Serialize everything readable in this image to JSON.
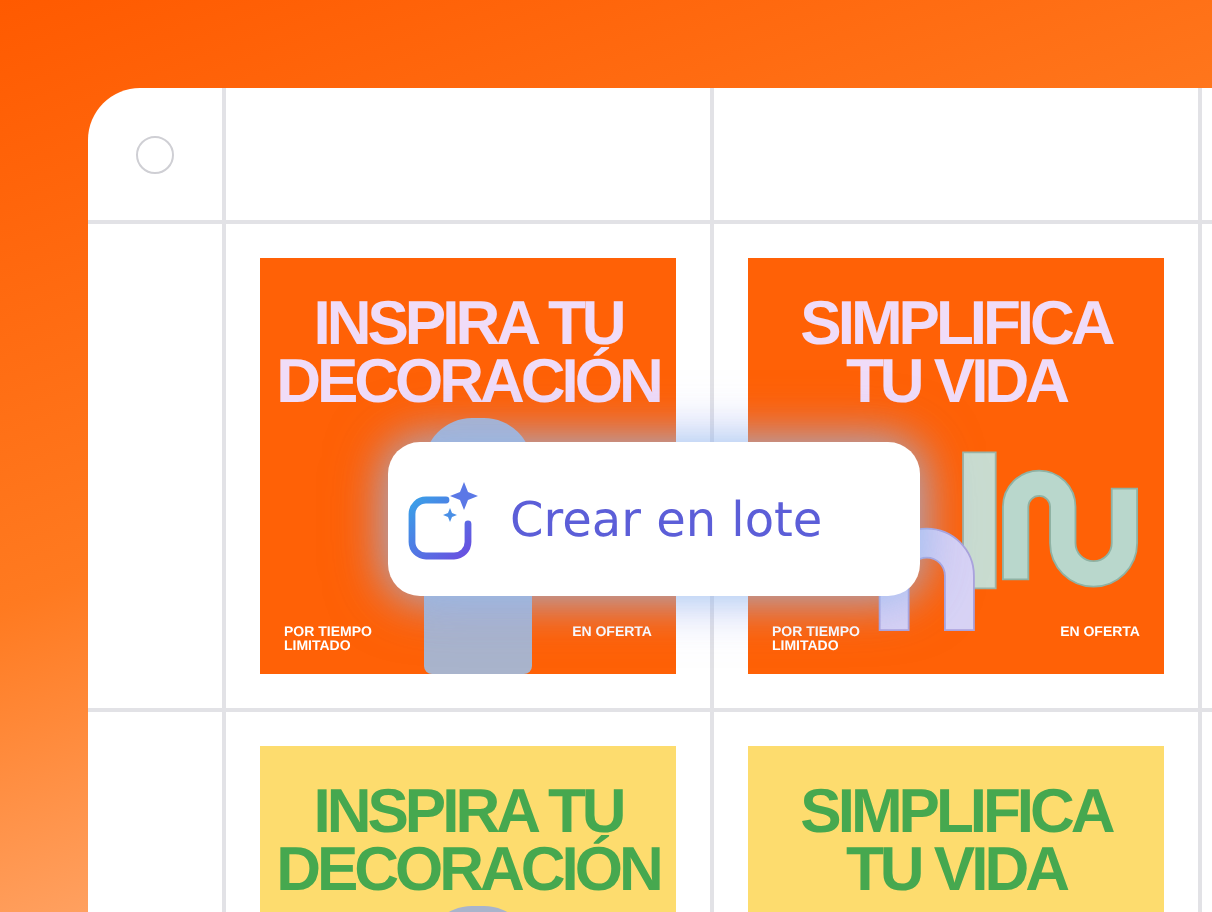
{
  "select_all": {
    "checked": false
  },
  "action_button": {
    "label": "Crear en lote"
  },
  "rows": [
    {
      "kind": "orange",
      "cards": [
        {
          "kind": "photo",
          "headline": [
            "INSPIRA TU",
            "DECORACIÓN"
          ],
          "footer_left": "POR TIEMPO LIMITADO",
          "footer_right": "EN OFERTA"
        },
        {
          "kind": "sculpture",
          "headline": [
            "SIMPLIFICA",
            "TU VIDA"
          ],
          "footer_left": "POR TIEMPO LIMITADO",
          "footer_right": "EN OFERTA"
        }
      ]
    },
    {
      "kind": "yellow",
      "cards": [
        {
          "kind": "photo",
          "headline": [
            "INSPIRA TU",
            "DECORACIÓN"
          ]
        },
        {
          "kind": "sculpture",
          "headline": [
            "SIMPLIFICA",
            "TU VIDA"
          ]
        }
      ]
    }
  ]
}
